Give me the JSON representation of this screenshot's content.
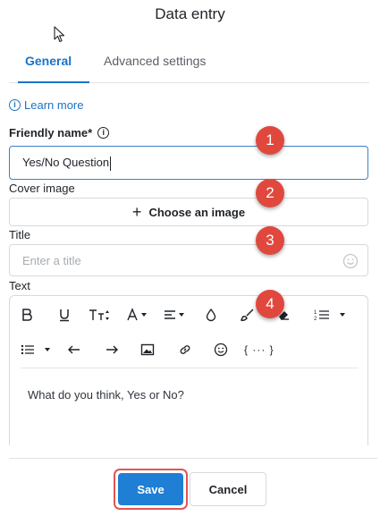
{
  "dialog": {
    "title": "Data entry"
  },
  "tabs": [
    {
      "label": "General",
      "active": true
    },
    {
      "label": "Advanced settings",
      "active": false
    }
  ],
  "learn_more": "Learn more",
  "friendly_name": {
    "label": "Friendly name*",
    "value": "Yes/No Question"
  },
  "cover_image": {
    "label": "Cover image",
    "button": "Choose an image"
  },
  "title_field": {
    "label": "Title",
    "placeholder": "Enter a title"
  },
  "text_field": {
    "label": "Text",
    "content": "What do you think, Yes or No?",
    "toolbar_row1": [
      "bold-icon",
      "underline-icon",
      "text-size-icon",
      "font-color-icon",
      "align-icon",
      "fill-color-icon",
      "highlight-icon",
      "eraser-icon",
      "numbered-list-icon"
    ],
    "toolbar_row2": [
      "bulleted-list-icon",
      "outdent-icon",
      "indent-icon",
      "image-icon",
      "link-icon",
      "emoji-icon",
      "variable-icon"
    ]
  },
  "footer": {
    "save_label": "Save",
    "cancel_label": "Cancel"
  },
  "badges": [
    "1",
    "2",
    "3",
    "4"
  ],
  "colors": {
    "accent": "#1a73c8",
    "primary_button": "#1e7fd4",
    "badge": "#e0483e",
    "highlight_outline": "#e05555"
  }
}
